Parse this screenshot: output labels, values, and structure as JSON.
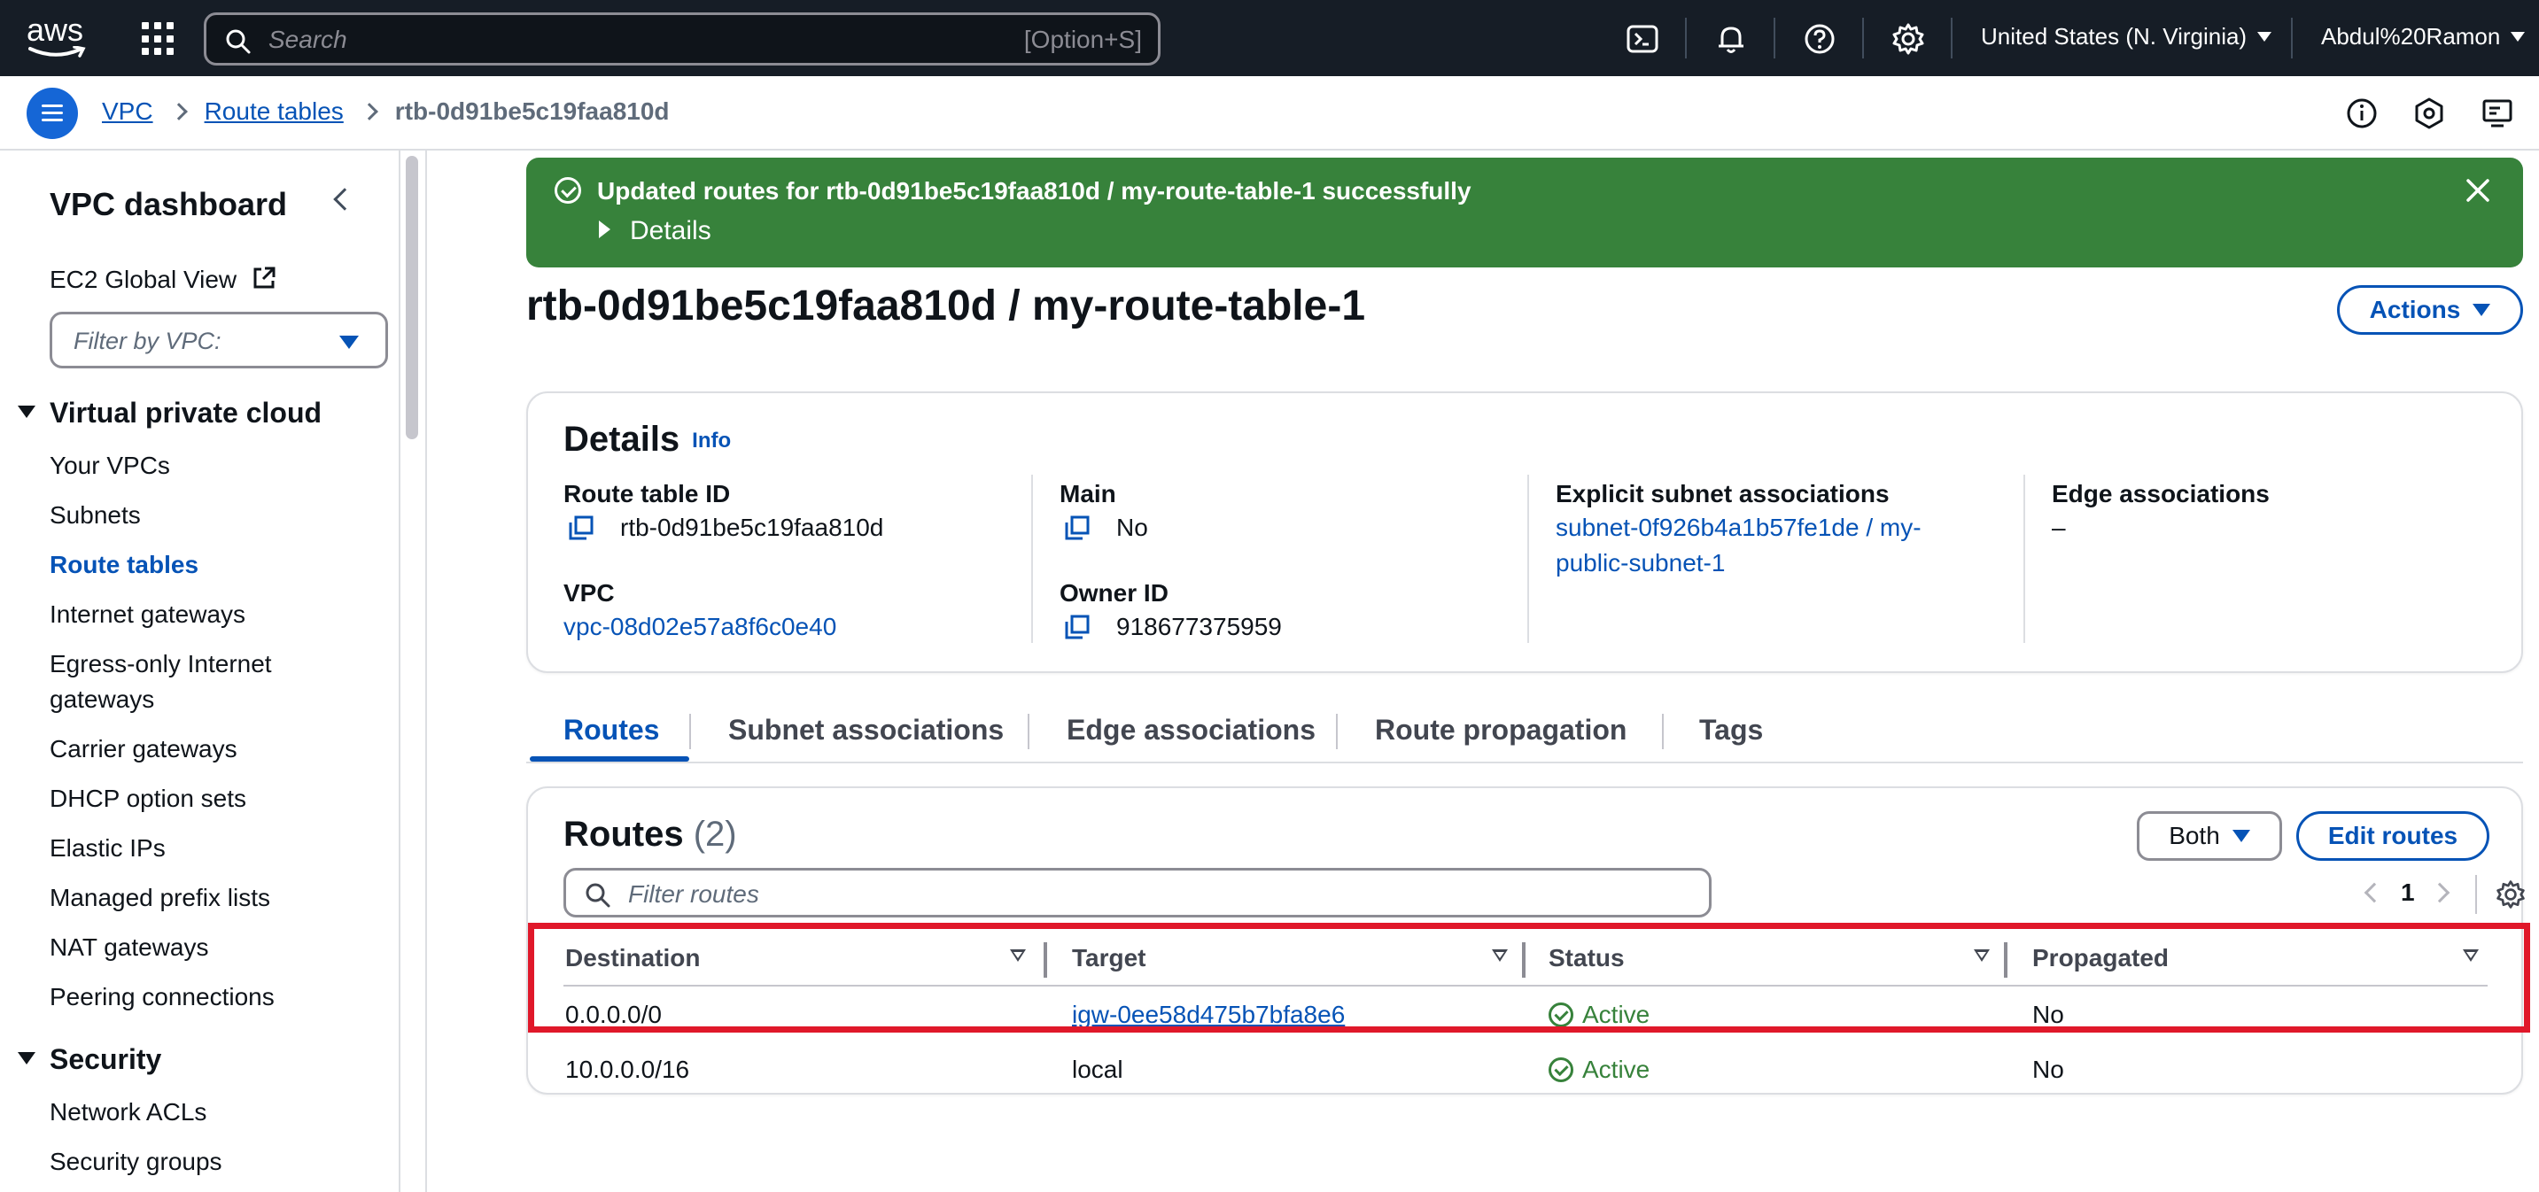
{
  "topnav": {
    "logo": "aws",
    "search_placeholder": "Search",
    "search_shortcut": "[Option+S]",
    "icons": [
      "cloudshell-icon",
      "bell-icon",
      "help-icon",
      "settings-icon"
    ],
    "region": "United States (N. Virginia)",
    "user": "Abdul%20Ramon"
  },
  "breadcrumb": {
    "items": [
      "VPC",
      "Route tables"
    ],
    "current": "rtb-0d91be5c19faa810d"
  },
  "sidebar": {
    "title": "VPC dashboard",
    "ec2_global_view": "EC2 Global View",
    "filter_placeholder": "Filter by VPC:",
    "sections": [
      {
        "label": "Virtual private cloud",
        "items": [
          "Your VPCs",
          "Subnets",
          "Route tables",
          "Internet gateways",
          "Egress-only Internet",
          "gateways",
          "Carrier gateways",
          "DHCP option sets",
          "Elastic IPs",
          "Managed prefix lists",
          "NAT gateways",
          "Peering connections"
        ]
      },
      {
        "label": "Security",
        "items": [
          "Network ACLs",
          "Security groups"
        ]
      }
    ],
    "active_item": "Route tables"
  },
  "flash": {
    "message": "Updated routes for rtb-0d91be5c19faa810d / my-route-table-1 successfully",
    "details_label": "Details",
    "color": "#37823b"
  },
  "page": {
    "title": "rtb-0d91be5c19faa810d / my-route-table-1",
    "actions_label": "Actions"
  },
  "details": {
    "heading": "Details",
    "info_label": "Info",
    "route_table_id_label": "Route table ID",
    "route_table_id": "rtb-0d91be5c19faa810d",
    "vpc_label": "VPC",
    "vpc_value": "vpc-08d02e57a8f6c0e40",
    "main_label": "Main",
    "main_value": "No",
    "owner_label": "Owner ID",
    "owner_value": "918677375959",
    "explicit_label": "Explicit subnet associations",
    "explicit_line1": "subnet-0f926b4a1b57fe1de / my-",
    "explicit_line2": "public-subnet-1",
    "edge_label": "Edge associations",
    "edge_value": "–"
  },
  "tabs": [
    "Routes",
    "Subnet associations",
    "Edge associations",
    "Route propagation",
    "Tags"
  ],
  "routes": {
    "heading": "Routes",
    "count": "(2)",
    "filter_select": "Both",
    "edit_label": "Edit routes",
    "filter_placeholder": "Filter routes",
    "page": "1",
    "columns": [
      "Destination",
      "Target",
      "Status",
      "Propagated"
    ],
    "rows": [
      {
        "destination": "0.0.0.0/0",
        "target": "igw-0ee58d475b7bfa8e6",
        "target_is_link": true,
        "status": "Active",
        "propagated": "No"
      },
      {
        "destination": "10.0.0.0/16",
        "target": "local",
        "target_is_link": false,
        "status": "Active",
        "propagated": "No"
      }
    ]
  },
  "colors": {
    "link": "#0653b6",
    "nav_bg": "#161d26",
    "success": "#37823b",
    "highlight": "#e0182a"
  }
}
